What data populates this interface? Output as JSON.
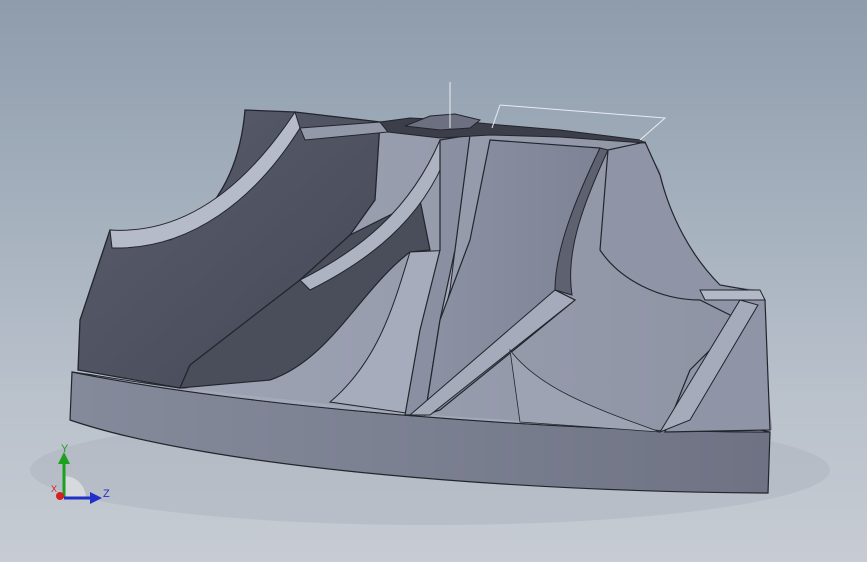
{
  "viewport": {
    "model_name": "impeller",
    "colors": {
      "background_top": "#8e9cac",
      "background_bottom": "#c7ccd3",
      "base_side": "#7d8293",
      "base_top": "#9ba0b1",
      "blade_light": "#8b90a2",
      "blade_dark": "#4b4f5c",
      "hub": "#a0a5b6",
      "edge": "#23252c",
      "sketch_line": "#e8ecf2"
    }
  },
  "triad": {
    "x_label": "X",
    "y_label": "Y",
    "z_label": "Z",
    "x_color": "#d42020",
    "y_color": "#1da01d",
    "z_color": "#2030c8"
  }
}
